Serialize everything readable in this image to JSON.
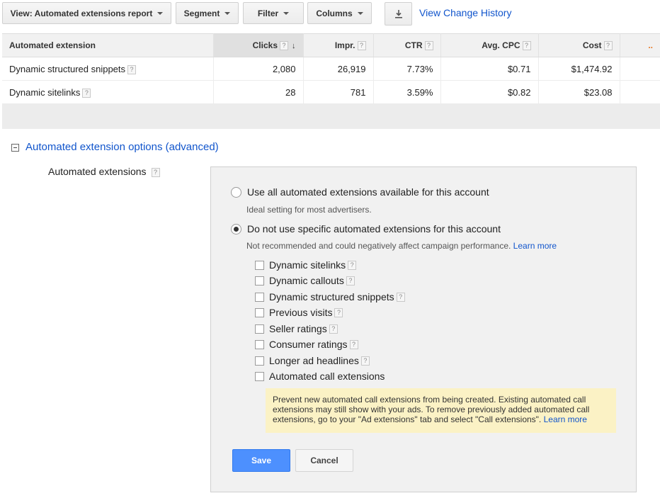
{
  "toolbar": {
    "view_label": "View: Automated extensions report",
    "segment_label": "Segment",
    "filter_label": "Filter",
    "columns_label": "Columns",
    "download_icon": "download-icon",
    "view_change_history": "View Change History"
  },
  "table": {
    "headers": {
      "extension": "Automated extension",
      "clicks": "Clicks",
      "impr": "Impr.",
      "ctr": "CTR",
      "avg_cpc": "Avg. CPC",
      "cost": "Cost",
      "more": ".."
    },
    "rows": [
      {
        "name": "Dynamic structured snippets",
        "clicks": "2,080",
        "impr": "26,919",
        "ctr": "7.73%",
        "avg_cpc": "$0.71",
        "cost": "$1,474.92"
      },
      {
        "name": "Dynamic sitelinks",
        "clicks": "28",
        "impr": "781",
        "ctr": "3.59%",
        "avg_cpc": "$0.82",
        "cost": "$23.08"
      }
    ]
  },
  "options": {
    "section_title": "Automated extension options (advanced)",
    "field_label": "Automated extensions",
    "radio_all": {
      "label": "Use all automated extensions available for this account",
      "hint": "Ideal setting for most advertisers.",
      "selected": false
    },
    "radio_specific": {
      "label": "Do not use specific automated extensions for this account",
      "hint": "Not recommended and could negatively affect campaign performance.",
      "learn_more": "Learn more",
      "selected": true
    },
    "checkboxes": [
      {
        "label": "Dynamic sitelinks",
        "checked": false,
        "help": true
      },
      {
        "label": "Dynamic callouts",
        "checked": false,
        "help": true
      },
      {
        "label": "Dynamic structured snippets",
        "checked": false,
        "help": true
      },
      {
        "label": "Previous visits",
        "checked": false,
        "help": true
      },
      {
        "label": "Seller ratings",
        "checked": false,
        "help": true
      },
      {
        "label": "Consumer ratings",
        "checked": false,
        "help": true
      },
      {
        "label": "Longer ad headlines",
        "checked": false,
        "help": true
      },
      {
        "label": "Automated call extensions",
        "checked": false,
        "help": false
      }
    ],
    "notice_text": "Prevent new automated call extensions from being created. Existing automated call extensions may still show with your ads. To remove previously added automated call extensions, go to your \"Ad extensions\" tab and select \"Call extensions\".",
    "notice_learn_more": "Learn more",
    "save_label": "Save",
    "cancel_label": "Cancel"
  },
  "help_glyph": "?",
  "sort_glyph": "↓",
  "colors": {
    "link": "#1155cc",
    "save_button": "#4d90fe",
    "notice_bg": "#fbf2c5",
    "accent_orange": "#e87722"
  }
}
